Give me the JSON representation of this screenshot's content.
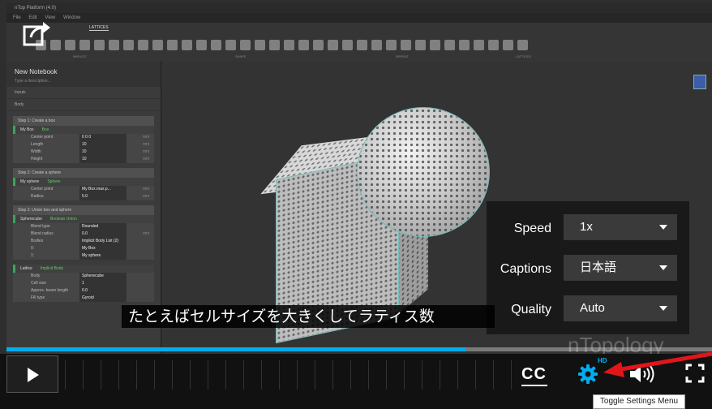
{
  "app": {
    "title": "nTop Platform (4.0)",
    "menu": [
      "File",
      "Edit",
      "View",
      "Window"
    ],
    "ribbon_tabs": [
      "LATTICES"
    ],
    "ribbon_groups": [
      "IMPLICIT",
      "SHAPE",
      "REPEAT",
      "LATTICES"
    ]
  },
  "notebook": {
    "title": "New Notebook",
    "description_placeholder": "Type a description...",
    "sections": [
      "Inputs",
      "Body"
    ],
    "steps": [
      {
        "title": "Step 1: Create a box",
        "block": "My Box",
        "type": "Box",
        "rows": [
          {
            "k": "Center point",
            "v": "0   0   0",
            "u": "mm"
          },
          {
            "k": "Length",
            "v": "10",
            "u": "mm"
          },
          {
            "k": "Width",
            "v": "10",
            "u": "mm"
          },
          {
            "k": "Height",
            "v": "10",
            "u": "mm"
          }
        ]
      },
      {
        "title": "Step 2: Create a sphere",
        "block": "My sphere",
        "type": "Sphere",
        "rows": [
          {
            "k": "Center point",
            "v": "My Box.max.p...",
            "u": "mm"
          },
          {
            "k": "Radius",
            "v": "5.0",
            "u": "mm"
          }
        ]
      },
      {
        "title": "Step 3: Union box and sphere",
        "block": "Spherecube",
        "type": "Boolean Union",
        "rows": [
          {
            "k": "Blend type",
            "v": "Rounded",
            "u": ""
          },
          {
            "k": "Blend radius",
            "v": "0.0",
            "u": "mm"
          },
          {
            "k": "Bodies",
            "v": "Implicit Body List (2)",
            "u": ""
          },
          {
            "k": "0:",
            "v": "My Box",
            "u": ""
          },
          {
            "k": "1:",
            "v": "My sphere",
            "u": ""
          }
        ]
      },
      {
        "title": "",
        "block": "Lattice",
        "type": "Implicit Body",
        "rows": [
          {
            "k": "Body",
            "v": "Spherecube",
            "u": ""
          },
          {
            "k": "Cell size",
            "v": "1",
            "u": ""
          },
          {
            "k": "Approx. beam length",
            "v": "0.0",
            "u": ""
          },
          {
            "k": "Fill type",
            "v": "Gyroid",
            "u": ""
          }
        ]
      }
    ]
  },
  "player": {
    "settings": {
      "speed_label": "Speed",
      "speed_value": "1x",
      "captions_label": "Captions",
      "captions_value": "日本語",
      "quality_label": "Quality",
      "quality_value": "Auto"
    },
    "caption_text": "たとえばセルサイズを大きくしてラティス数",
    "watermark": "nTopology",
    "progress_fraction": 0.65,
    "cc_label": "CC",
    "hd_badge": "HD",
    "tooltip": "Toggle Settings Menu",
    "colors": {
      "accent": "#00adef",
      "arrow": "#e0161b"
    }
  }
}
